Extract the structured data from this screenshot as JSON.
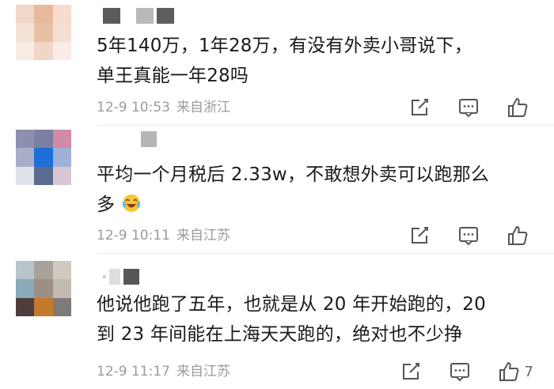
{
  "comments": [
    {
      "text_lines": [
        "5年140万，1年28万，有没有外卖小哥说下，",
        "单王真能一年28吗"
      ],
      "date": "12-9 10:53",
      "location": "来自浙江",
      "like_count": ""
    },
    {
      "text_lines": [
        "平均一个月税后 2.33w，不敢想外卖可以跑那么",
        "多"
      ],
      "emoji": "crying-laughing-emoji",
      "date": "12-9 10:11",
      "location": "来自江苏",
      "like_count": ""
    },
    {
      "text_lines": [
        "他说他跑了五年，也就是从 20 年开始跑的，20",
        "到 23 年间能在上海天天跑的，绝对也不少挣"
      ],
      "date": "12-9 11:17",
      "location": "来自江苏",
      "like_count": "7"
    }
  ],
  "icons": {
    "share": "share-icon",
    "reply": "reply-icon",
    "like": "thumbs-up-icon"
  },
  "colors": {
    "meta_gray": "#9b9b9b",
    "icon_gray": "#666666",
    "divider": "#ececec"
  }
}
